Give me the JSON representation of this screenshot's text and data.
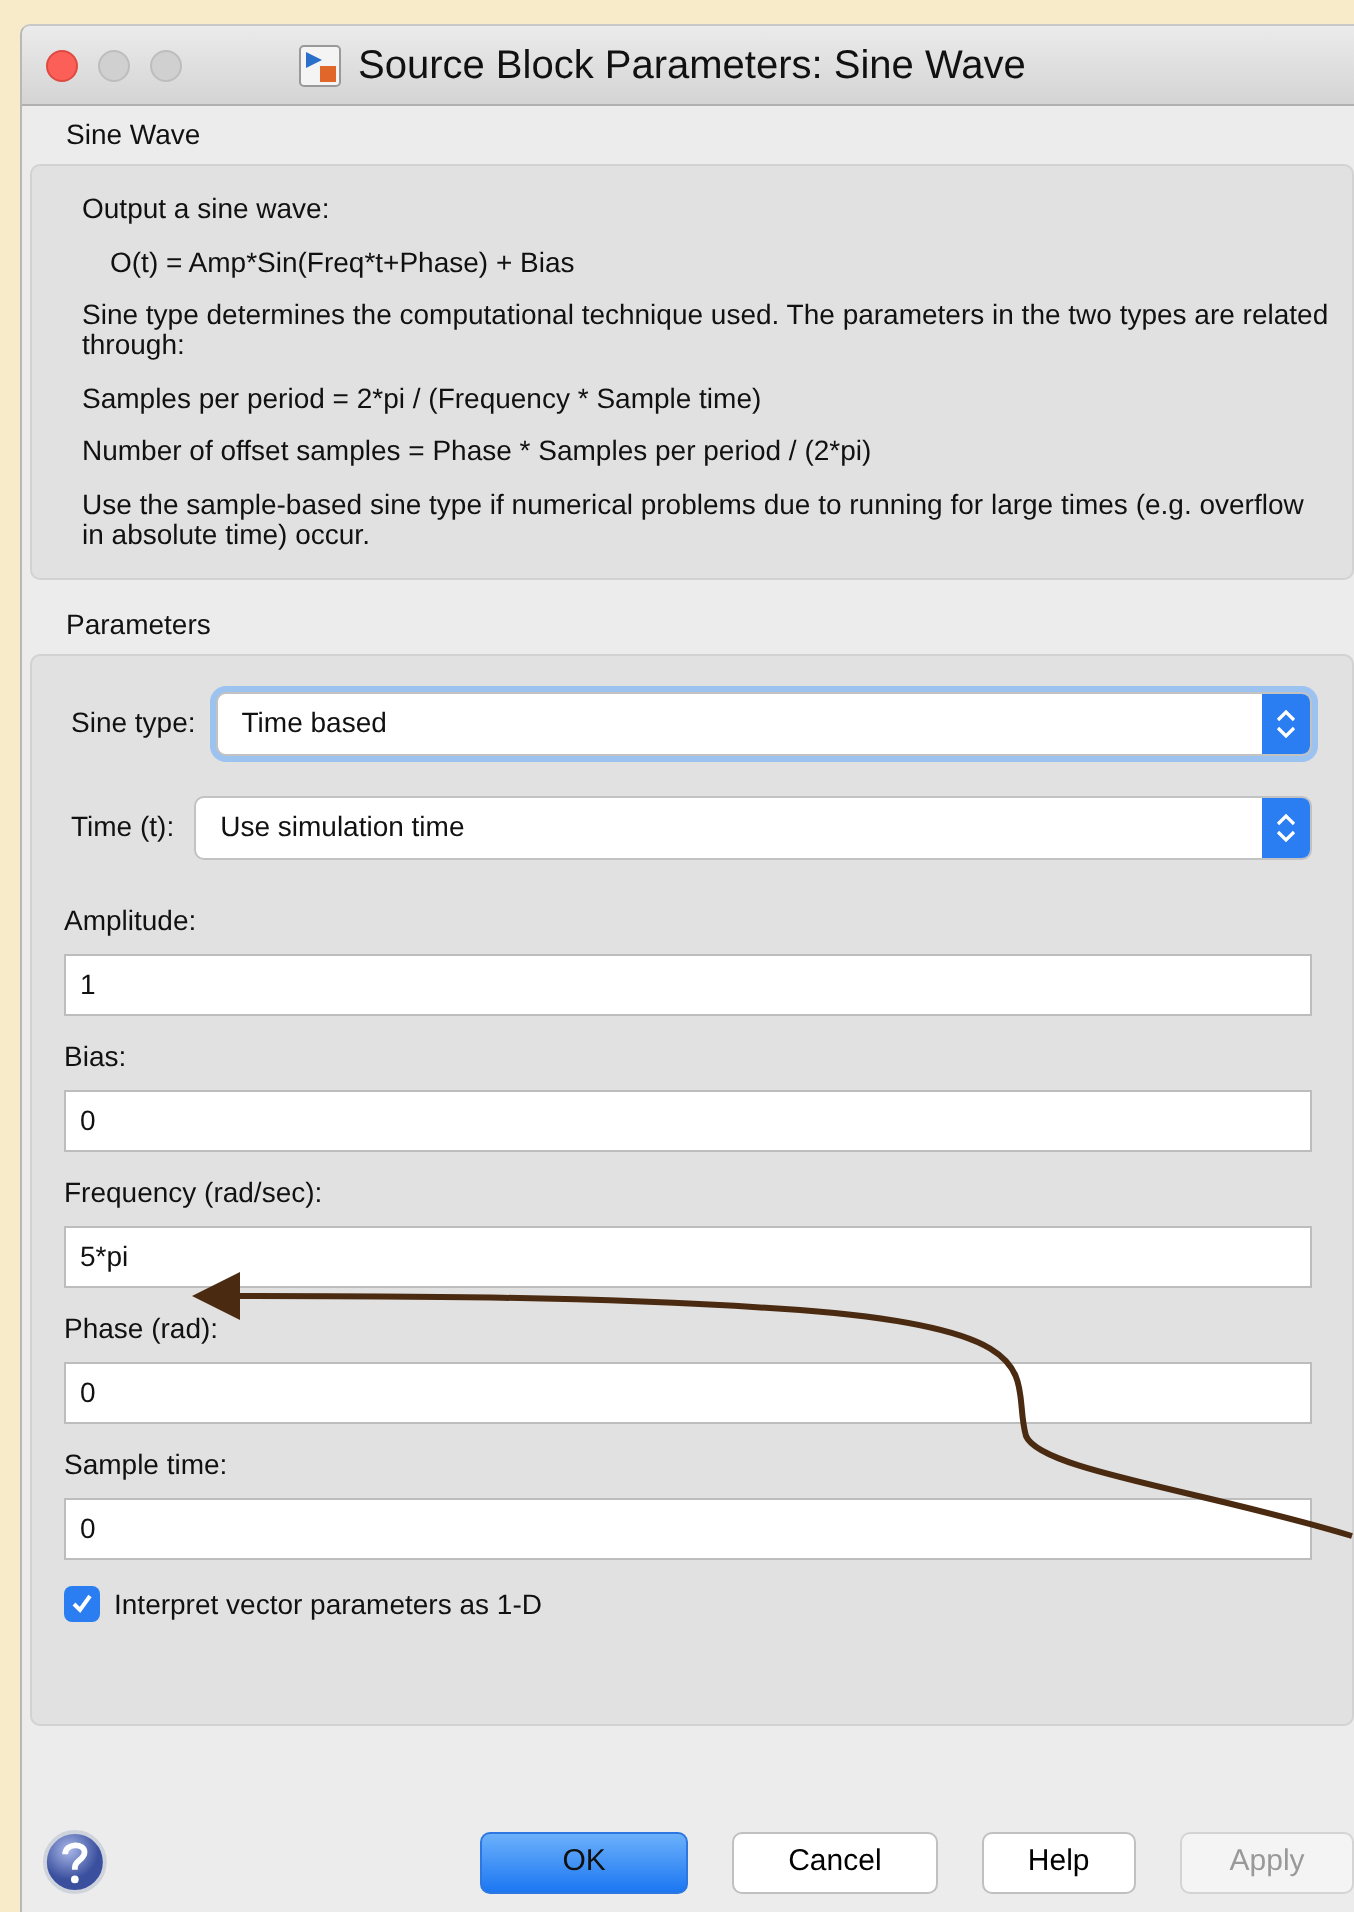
{
  "window": {
    "title": "Source Block Parameters: Sine Wave"
  },
  "description": {
    "heading": "Sine Wave",
    "paragraphs": [
      "Output a sine wave:",
      "O(t) = Amp*Sin(Freq*t+Phase) + Bias",
      "Sine type determines the computational technique used. The parameters in the two types are related through:",
      "Samples per period = 2*pi / (Frequency * Sample time)",
      "Number of offset samples = Phase * Samples per period / (2*pi)",
      "Use the sample-based sine type if numerical problems due to running for large times (e.g. overflow in absolute time) occur."
    ]
  },
  "parameters": {
    "heading": "Parameters",
    "items": [
      {
        "kind": "select",
        "label": "Sine type:",
        "value": "Time based",
        "focused": true
      },
      {
        "kind": "select",
        "label": "Time (t):",
        "value": "Use simulation time",
        "focused": false
      },
      {
        "kind": "field",
        "label": "Amplitude:",
        "value": "1"
      },
      {
        "kind": "field",
        "label": "Bias:",
        "value": "0"
      },
      {
        "kind": "field",
        "label": "Frequency (rad/sec):",
        "value": "5*pi"
      },
      {
        "kind": "field",
        "label": "Phase (rad):",
        "value": "0"
      },
      {
        "kind": "field",
        "label": "Sample time:",
        "value": "0"
      },
      {
        "kind": "checkbox",
        "label": "Interpret vector parameters as 1-D",
        "checked": true
      }
    ]
  },
  "buttons": [
    {
      "label": "OK",
      "default": true,
      "disabled": false
    },
    {
      "label": "Cancel",
      "default": false,
      "disabled": false
    },
    {
      "label": "Help",
      "default": false,
      "disabled": false
    },
    {
      "label": "Apply",
      "default": false,
      "disabled": true
    }
  ]
}
